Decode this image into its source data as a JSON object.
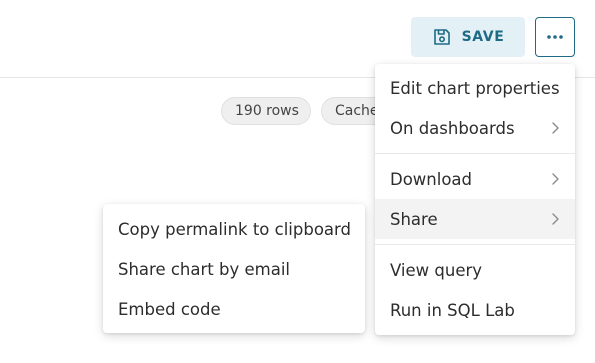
{
  "header": {
    "save_label": "SAVE",
    "save_icon": "floppy-disk-icon",
    "more_icon": "ellipsis-icon"
  },
  "pills": {
    "rows": "190 rows",
    "cache": "Cached"
  },
  "main_menu": {
    "items": [
      {
        "label": "Edit chart properties",
        "submenu": false
      },
      {
        "label": "On dashboards",
        "submenu": true
      },
      {
        "label": "Download",
        "submenu": true
      },
      {
        "label": "Share",
        "submenu": true,
        "active": true
      },
      {
        "label": "View query",
        "submenu": false
      },
      {
        "label": "Run in SQL Lab",
        "submenu": false
      }
    ]
  },
  "share_menu": {
    "items": [
      {
        "label": "Copy permalink to clipboard"
      },
      {
        "label": "Share chart by email"
      },
      {
        "label": "Embed code"
      }
    ]
  },
  "colors": {
    "accent": "#1f6b86",
    "save_bg": "#e3f1f6",
    "active_item_bg": "#f3f3f3",
    "pill_bg": "#efefef"
  }
}
